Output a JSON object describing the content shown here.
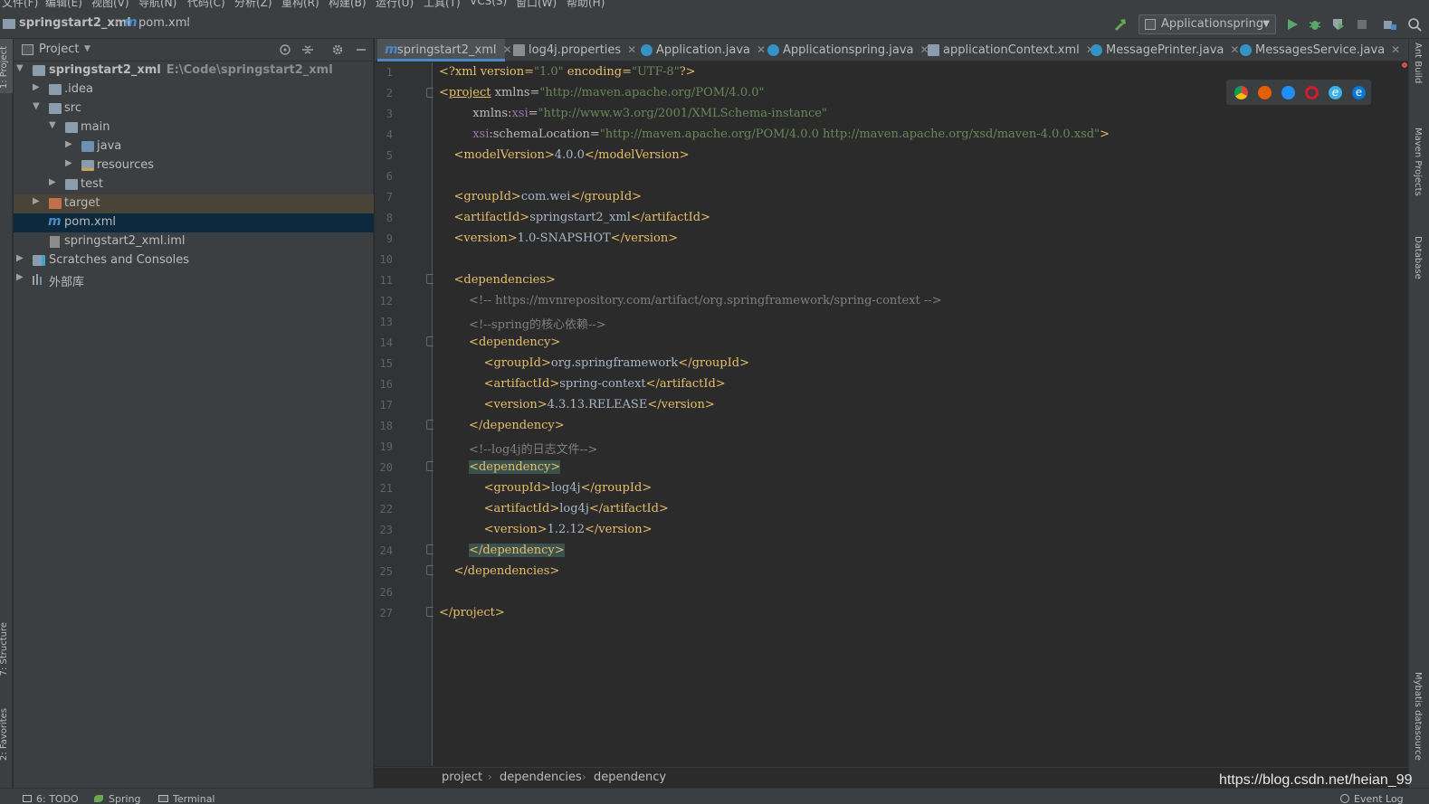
{
  "menu": [
    "文件(F)",
    "编辑(E)",
    "视图(V)",
    "导航(N)",
    "代码(C)",
    "分析(Z)",
    "重构(R)",
    "构建(B)",
    "运行(U)",
    "工具(T)",
    "VCS(S)",
    "窗口(W)",
    "帮助(H)"
  ],
  "navbar": {
    "project": "springstart2_xml",
    "file": "pom.xml",
    "run_config": "Applicationspring"
  },
  "left_tabs": {
    "project": "1: Project",
    "structure": "7: Structure",
    "favorites": "2: Favorites"
  },
  "right_tabs": {
    "ant": "Ant Build",
    "maven": "Maven Projects",
    "database": "Database",
    "mybatis": "Mybatis datasource"
  },
  "project_panel": {
    "title": "Project",
    "tree": [
      {
        "label": "springstart2_xml",
        "path": "E:\\Code\\springstart2_xml"
      },
      {
        "label": ".idea"
      },
      {
        "label": "src"
      },
      {
        "label": "main"
      },
      {
        "label": "java"
      },
      {
        "label": "resources"
      },
      {
        "label": "test"
      },
      {
        "label": "target"
      },
      {
        "label": "pom.xml"
      },
      {
        "label": "springstart2_xml.iml"
      },
      {
        "label": "Scratches and Consoles"
      },
      {
        "label": "外部库"
      }
    ]
  },
  "tabs": [
    {
      "label": "springstart2_xml"
    },
    {
      "label": "log4j.properties"
    },
    {
      "label": "Application.java"
    },
    {
      "label": "Applicationspring.java"
    },
    {
      "label": "applicationContext.xml"
    },
    {
      "label": "MessagePrinter.java"
    },
    {
      "label": "MessagesService.java"
    }
  ],
  "line_numbers": [
    "1",
    "2",
    "3",
    "4",
    "5",
    "6",
    "7",
    "8",
    "9",
    "10",
    "11",
    "12",
    "13",
    "14",
    "15",
    "16",
    "17",
    "18",
    "19",
    "20",
    "21",
    "22",
    "23",
    "24",
    "25",
    "26",
    "27"
  ],
  "code": {
    "l1": {
      "a": "<?xml version=",
      "b": "\"1.0\"",
      "c": " encoding=",
      "d": "\"UTF-8\"",
      "e": "?>"
    },
    "l2": {
      "a": "<",
      "b": "project",
      "c": " xmlns=",
      "d": "\"http://maven.apache.org/POM/4.0.0\""
    },
    "l3": {
      "a": "         xmlns:",
      "b": "xsi",
      "c": "=",
      "d": "\"http://www.w3.org/2001/XMLSchema-instance\""
    },
    "l4": {
      "a": "         ",
      "b": "xsi",
      "c": ":schemaLocation=",
      "d": "\"http://maven.apache.org/POM/4.0.0 http://maven.apache.org/xsd/maven-4.0.0.xsd\"",
      "e": ">"
    },
    "l5": {
      "a": "    <modelVersion>",
      "b": "4.0.0",
      "c": "</modelVersion>"
    },
    "l7": {
      "a": "    <groupId>",
      "b": "com.wei",
      "c": "</groupId>"
    },
    "l8": {
      "a": "    <artifactId>",
      "b": "springstart2_xml",
      "c": "</artifactId>"
    },
    "l9": {
      "a": "    <version>",
      "b": "1.0-SNAPSHOT",
      "c": "</version>"
    },
    "l11": {
      "a": "    <dependencies>"
    },
    "l12": {
      "a": "        <!-- https://mvnrepository.com/artifact/org.springframework/spring-context -->"
    },
    "l13": {
      "a": "        <!--spring的核心依赖-->"
    },
    "l14": {
      "a": "        <dependency>"
    },
    "l15": {
      "a": "            <groupId>",
      "b": "org.springframework",
      "c": "</groupId>"
    },
    "l16": {
      "a": "            <artifactId>",
      "b": "spring-context",
      "c": "</artifactId>"
    },
    "l17": {
      "a": "            <version>",
      "b": "4.3.13.RELEASE",
      "c": "</version>"
    },
    "l18": {
      "a": "        </dependency>"
    },
    "l19": {
      "a": "        <!--log4j的日志文件-->"
    },
    "l20": {
      "a": "<dependency>"
    },
    "l21": {
      "a": "            <groupId>",
      "b": "log4j",
      "c": "</groupId>"
    },
    "l22": {
      "a": "            <artifactId>",
      "b": "log4j",
      "c": "</artifactId>"
    },
    "l23": {
      "a": "            <version>",
      "b": "1.2.12",
      "c": "</version>"
    },
    "l24": {
      "a": "</dependency>"
    },
    "l25": {
      "a": "    </dependencies>"
    },
    "l27": {
      "a": "</project>"
    }
  },
  "breadcrumb": [
    "project",
    "dependencies",
    "dependency"
  ],
  "watermark": "https://blog.csdn.net/heian_99",
  "statusbar": {
    "todo": "6: TODO",
    "spring": "Spring",
    "terminal": "Terminal",
    "event_log": "Event Log"
  },
  "colors": {
    "tag": "#e8bf6a",
    "string": "#6a8759",
    "comment": "#808080",
    "accent": "#4a88c7"
  }
}
